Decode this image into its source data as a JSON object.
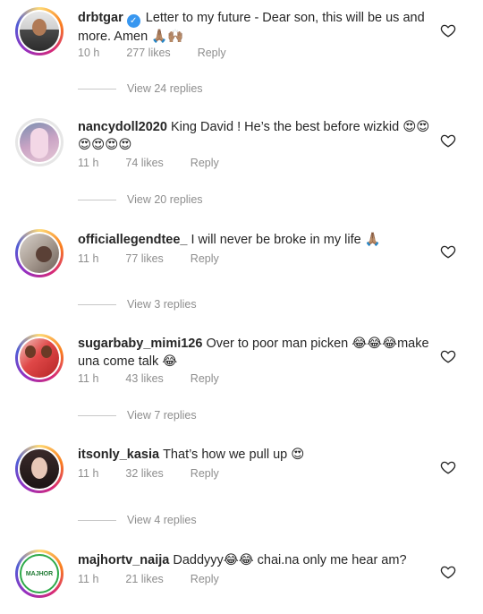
{
  "comments": [
    {
      "username": "drbtgar",
      "verified": true,
      "text": "Letter to my future - Dear son, this will be us and more. Amen 🙏🏽🙌🏽",
      "time": "10 h",
      "likes": "277 likes",
      "reply": "Reply",
      "view_replies": "View 24 replies"
    },
    {
      "username": "nancydoll2020",
      "verified": false,
      "text": "King David ! He’s the best before wizkid 😍😍😍😍😍😍",
      "time": "11 h",
      "likes": "74 likes",
      "reply": "Reply",
      "view_replies": "View 20 replies"
    },
    {
      "username": "officiallegendtee_",
      "verified": false,
      "text": "I will never be broke in my life 🙏🏽",
      "time": "11 h",
      "likes": "77 likes",
      "reply": "Reply",
      "view_replies": "View 3 replies"
    },
    {
      "username": "sugarbaby_mimi126",
      "verified": false,
      "text": "Over to poor man picken 😂😂😂make una come talk 😂",
      "time": "11 h",
      "likes": "43 likes",
      "reply": "Reply",
      "view_replies": "View 7 replies"
    },
    {
      "username": "itsonly_kasia",
      "verified": false,
      "text": "That’s how we pull up 😍",
      "time": "11 h",
      "likes": "32 likes",
      "reply": "Reply",
      "view_replies": "View 4 replies"
    },
    {
      "username": "majhortv_naija",
      "verified": false,
      "text": "Daddyyy😂😂 chai.na only me hear am?",
      "time": "11 h",
      "likes": "21 likes",
      "reply": "Reply"
    }
  ],
  "avatar_logo_text": "MAJHOR",
  "colors": {
    "text": "#262626",
    "meta": "#8e8e8e",
    "verified": "#3897f0",
    "background": "#ffffff"
  }
}
